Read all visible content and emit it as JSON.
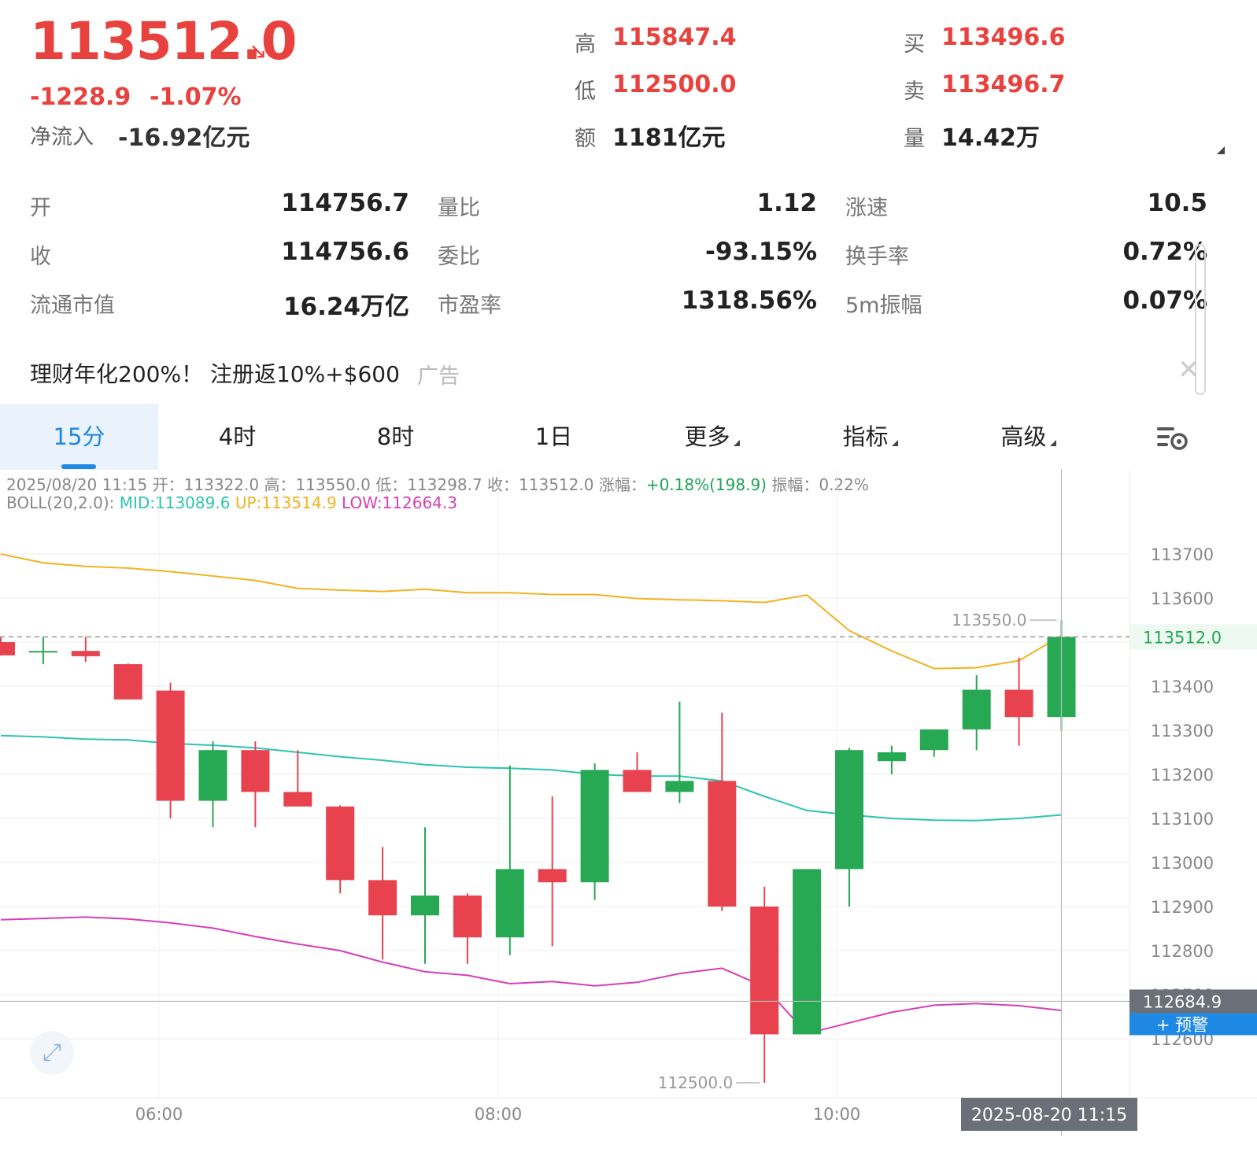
{
  "quote": {
    "price": "113512.0",
    "change": "-1228.9",
    "change_pct": "-1.07%",
    "net_inflow_label": "净流入",
    "net_inflow_value": "-16.92亿元",
    "high_label": "高",
    "high_value": "115847.4",
    "low_label": "低",
    "low_value": "112500.0",
    "amount_label": "额",
    "amount_value": "1181亿元",
    "bid_label": "买",
    "bid_value": "113496.6",
    "ask_label": "卖",
    "ask_value": "113496.7",
    "volume_label": "量",
    "volume_value": "14.42万"
  },
  "stats": [
    {
      "label": "开",
      "value": "114756.7"
    },
    {
      "label": "量比",
      "value": "1.12"
    },
    {
      "label": "涨速",
      "value": "10.5"
    },
    {
      "label": "收",
      "value": "114756.6"
    },
    {
      "label": "委比",
      "value": "-93.15%"
    },
    {
      "label": "换手率",
      "value": "0.72%"
    },
    {
      "label": "流通市值",
      "value": "16.24万亿"
    },
    {
      "label": "市盈率",
      "value": "1318.56%"
    },
    {
      "label": "5m振幅",
      "value": "0.07%"
    }
  ],
  "ad": {
    "text": "理财年化200%！ 注册返10%+$600",
    "tag": "广告",
    "close": "✕"
  },
  "tabs": [
    {
      "label": "15分",
      "active": true
    },
    {
      "label": "4时"
    },
    {
      "label": "8时"
    },
    {
      "label": "1日"
    },
    {
      "label": "更多",
      "dropdown": true
    },
    {
      "label": "指标",
      "dropdown": true
    },
    {
      "label": "高级",
      "dropdown": true
    }
  ],
  "settings_icon": "chart-settings-icon",
  "info": {
    "datetime": "2025/08/20 11:15",
    "open_label": "开：",
    "open": "113322.0",
    "high_label": "高：",
    "high": "113550.0",
    "low_label": "低：",
    "low": "113298.7",
    "close_label": "收：",
    "close": "113512.0",
    "chg_label": "涨幅：",
    "chg": "+0.18%(198.9)",
    "amp_label": "振幅：",
    "amp": "0.22%",
    "boll_label": "BOLL(20,2.0):",
    "mid": "MID:113089.6",
    "up": "UP:113514.9",
    "low_band": "LOW:112664.3"
  },
  "colors": {
    "up": "#27a853",
    "down": "#e8424f",
    "mid": "#2ec4ae",
    "upper": "#f0b323",
    "lower": "#d63fb5",
    "accent": "#1e88e5"
  },
  "chart_data": {
    "type": "candlestick",
    "x_tick_labels": [
      "06:00",
      "08:00",
      "10:00"
    ],
    "y_ticks": [
      112600,
      112700,
      112800,
      112900,
      113000,
      113100,
      113200,
      113300,
      113400,
      113500,
      113600,
      113700
    ],
    "ylim": [
      112450,
      113780
    ],
    "candles": [
      {
        "o": 113500,
        "h": 113512,
        "l": 113470,
        "c": 113470
      },
      {
        "o": 113480,
        "h": 113512,
        "l": 113450,
        "c": 113480
      },
      {
        "o": 113480,
        "h": 113512,
        "l": 113455,
        "c": 113468
      },
      {
        "o": 113450,
        "h": 113452,
        "l": 113370,
        "c": 113370
      },
      {
        "o": 113390,
        "h": 113408,
        "l": 113100,
        "c": 113140
      },
      {
        "o": 113140,
        "h": 113275,
        "l": 113080,
        "c": 113255
      },
      {
        "o": 113255,
        "h": 113275,
        "l": 113080,
        "c": 113160
      },
      {
        "o": 113160,
        "h": 113255,
        "l": 113140,
        "c": 113127
      },
      {
        "o": 113127,
        "h": 113130,
        "l": 112930,
        "c": 112960
      },
      {
        "o": 112960,
        "h": 113035,
        "l": 112780,
        "c": 112880
      },
      {
        "o": 112880,
        "h": 113080,
        "l": 112770,
        "c": 112925
      },
      {
        "o": 112925,
        "h": 112930,
        "l": 112770,
        "c": 112830
      },
      {
        "o": 112830,
        "h": 113220,
        "l": 112790,
        "c": 112985
      },
      {
        "o": 112985,
        "h": 113150,
        "l": 112810,
        "c": 112955
      },
      {
        "o": 112955,
        "h": 113225,
        "l": 112915,
        "c": 113210
      },
      {
        "o": 113210,
        "h": 113250,
        "l": 113160,
        "c": 113160
      },
      {
        "o": 113160,
        "h": 113365,
        "l": 113135,
        "c": 113185
      },
      {
        "o": 113185,
        "h": 113340,
        "l": 112890,
        "c": 112900
      },
      {
        "o": 112900,
        "h": 112945,
        "l": 112580,
        "c": 112610
      },
      {
        "o": 112610,
        "h": 112985,
        "l": 112610,
        "c": 112985
      },
      {
        "o": 112985,
        "h": 113260,
        "l": 112900,
        "c": 113255
      },
      {
        "o": 113230,
        "h": 113265,
        "l": 113200,
        "c": 113250
      },
      {
        "o": 113255,
        "h": 113302,
        "l": 113240,
        "c": 113302
      },
      {
        "o": 113302,
        "h": 113425,
        "l": 113255,
        "c": 113392
      },
      {
        "o": 113392,
        "h": 113465,
        "l": 113265,
        "c": 113330
      },
      {
        "o": 113330,
        "h": 113550,
        "l": 113298.7,
        "c": 113512
      }
    ],
    "boll_mid": [
      113288,
      113285,
      113280,
      113278,
      113270,
      113266,
      113260,
      113250,
      113240,
      113232,
      113222,
      113216,
      113214,
      113210,
      113200,
      113196,
      113196,
      113185,
      113150,
      113118,
      113108,
      113100,
      113096,
      113095,
      113100,
      113108
    ],
    "boll_up": [
      113700,
      113680,
      113672,
      113668,
      113660,
      113650,
      113640,
      113622,
      113618,
      113615,
      113620,
      113612,
      113612,
      113608,
      113608,
      113599,
      113596,
      113594,
      113590,
      113607,
      113526,
      113480,
      113440,
      113442,
      113458,
      113514.9
    ],
    "boll_low": [
      112870,
      112873,
      112876,
      112872,
      112863,
      112851,
      112832,
      112815,
      112800,
      112774,
      112752,
      112744,
      112725,
      112730,
      112720,
      112728,
      112748,
      112760,
      112718,
      112612,
      112636,
      112660,
      112676,
      112680,
      112675,
      112664.3
    ],
    "price_line": "113512.0",
    "crosshair_price": "112684.9",
    "max_marker": "113550.0",
    "min_marker": "112500.0",
    "cursor_time": "2025-08-20 11:15",
    "alert_label": "+ 预警"
  }
}
